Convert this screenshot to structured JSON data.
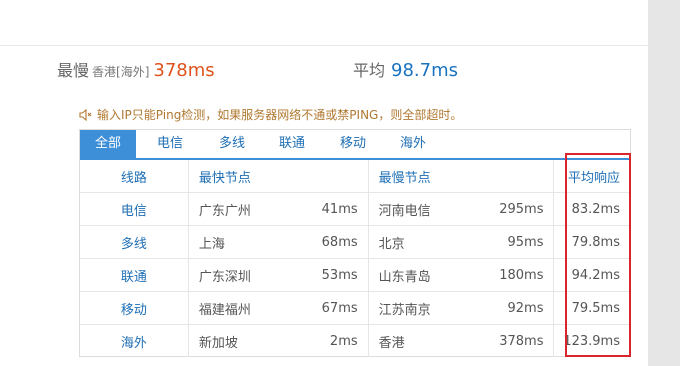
{
  "summary": {
    "slowest_label": "最慢",
    "slowest_region": "香港[海外]",
    "slowest_value": "378ms",
    "average_label": "平均",
    "average_value": "98.7ms"
  },
  "notice": {
    "icon": "speaker-icon",
    "text": "输入IP只能Ping检测，如果服务器网络不通或禁PING，则全部超时。"
  },
  "tabs": [
    "全部",
    "电信",
    "多线",
    "联通",
    "移动",
    "海外"
  ],
  "active_tab": "全部",
  "table": {
    "headers": {
      "line": "线路",
      "fastest": "最快节点",
      "slowest": "最慢节点",
      "average": "平均响应"
    },
    "rows": [
      {
        "line": "电信",
        "fast_node": "广东广州",
        "fast_ms": "41ms",
        "slow_node": "河南电信",
        "slow_ms": "295ms",
        "avg": "83.2ms"
      },
      {
        "line": "多线",
        "fast_node": "上海",
        "fast_ms": "68ms",
        "slow_node": "北京",
        "slow_ms": "95ms",
        "avg": "79.8ms"
      },
      {
        "line": "联通",
        "fast_node": "广东深圳",
        "fast_ms": "53ms",
        "slow_node": "山东青岛",
        "slow_ms": "180ms",
        "avg": "94.2ms"
      },
      {
        "line": "移动",
        "fast_node": "福建福州",
        "fast_ms": "67ms",
        "slow_node": "江苏南京",
        "slow_ms": "92ms",
        "avg": "79.5ms"
      },
      {
        "line": "海外",
        "fast_node": "新加坡",
        "fast_ms": "2ms",
        "slow_node": "香港",
        "slow_ms": "378ms",
        "avg": "123.9ms"
      }
    ]
  },
  "colors": {
    "accent_blue": "#3d8fd8",
    "link_blue": "#1f6fb5",
    "slow_red": "#e0521d",
    "highlight_red": "#d9262c",
    "notice_amber": "#b07830"
  }
}
